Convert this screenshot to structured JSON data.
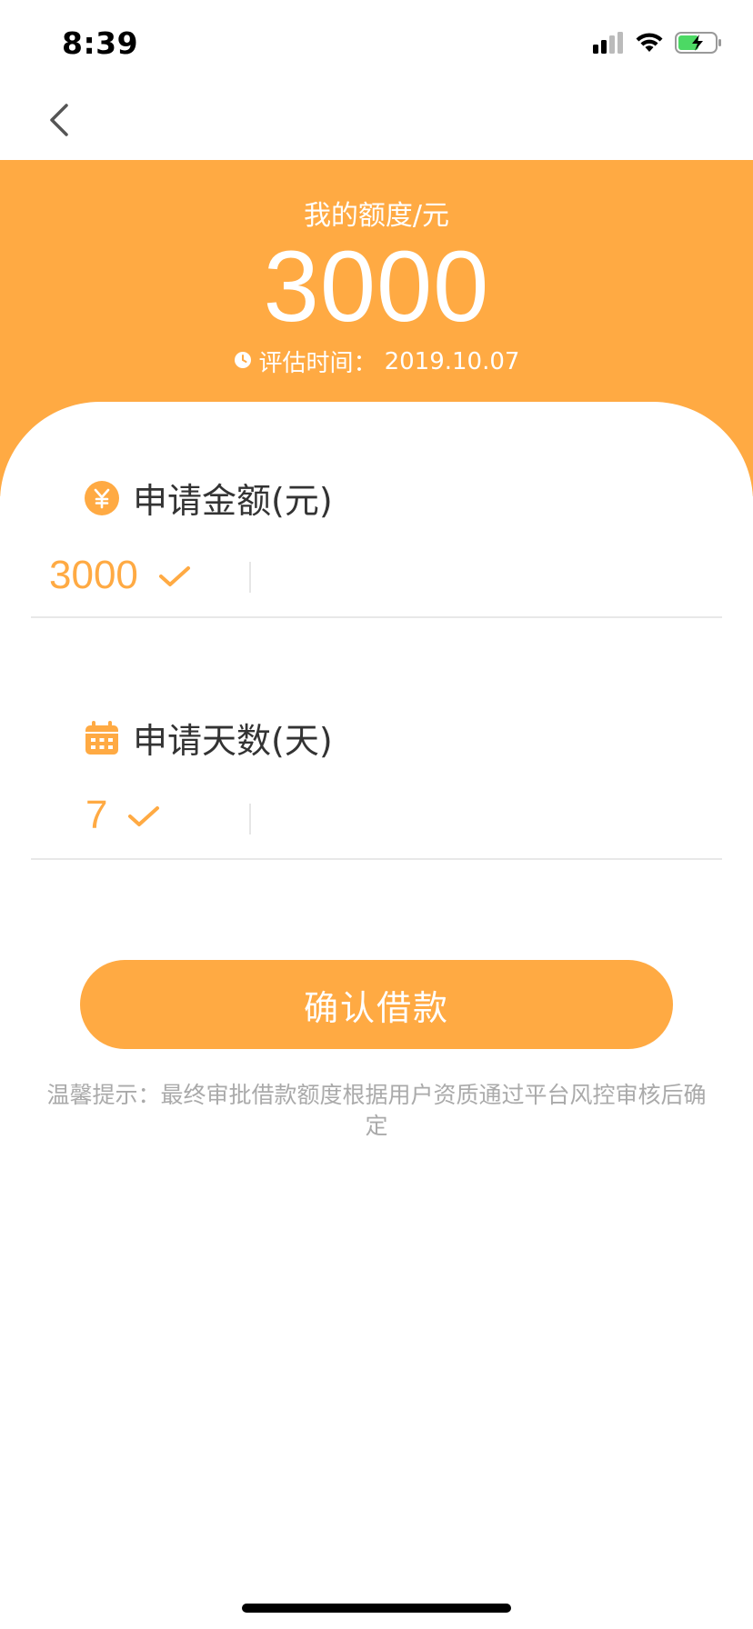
{
  "status_bar": {
    "time": "8:39"
  },
  "nav": {
    "back_icon": "chevron-left-icon"
  },
  "hero": {
    "label": "我的额度/元",
    "amount": "3000",
    "eval_time_label": "评估时间：",
    "eval_time_value": "2019.10.07",
    "bg_color": "#FFAA43"
  },
  "form": {
    "amount_field": {
      "title": "申请金额(元)",
      "icon": "yuan-coin-icon",
      "value": "3000"
    },
    "days_field": {
      "title": "申请天数(天)",
      "icon": "calendar-icon",
      "value": "7"
    }
  },
  "confirm_button": {
    "label": "确认借款"
  },
  "tip": {
    "text": "温馨提示：最终审批借款额度根据用户资质通过平台风控审核后确定"
  },
  "colors": {
    "accent": "#FFAA43",
    "text_primary": "#333333",
    "text_muted": "#AAAAAA"
  }
}
